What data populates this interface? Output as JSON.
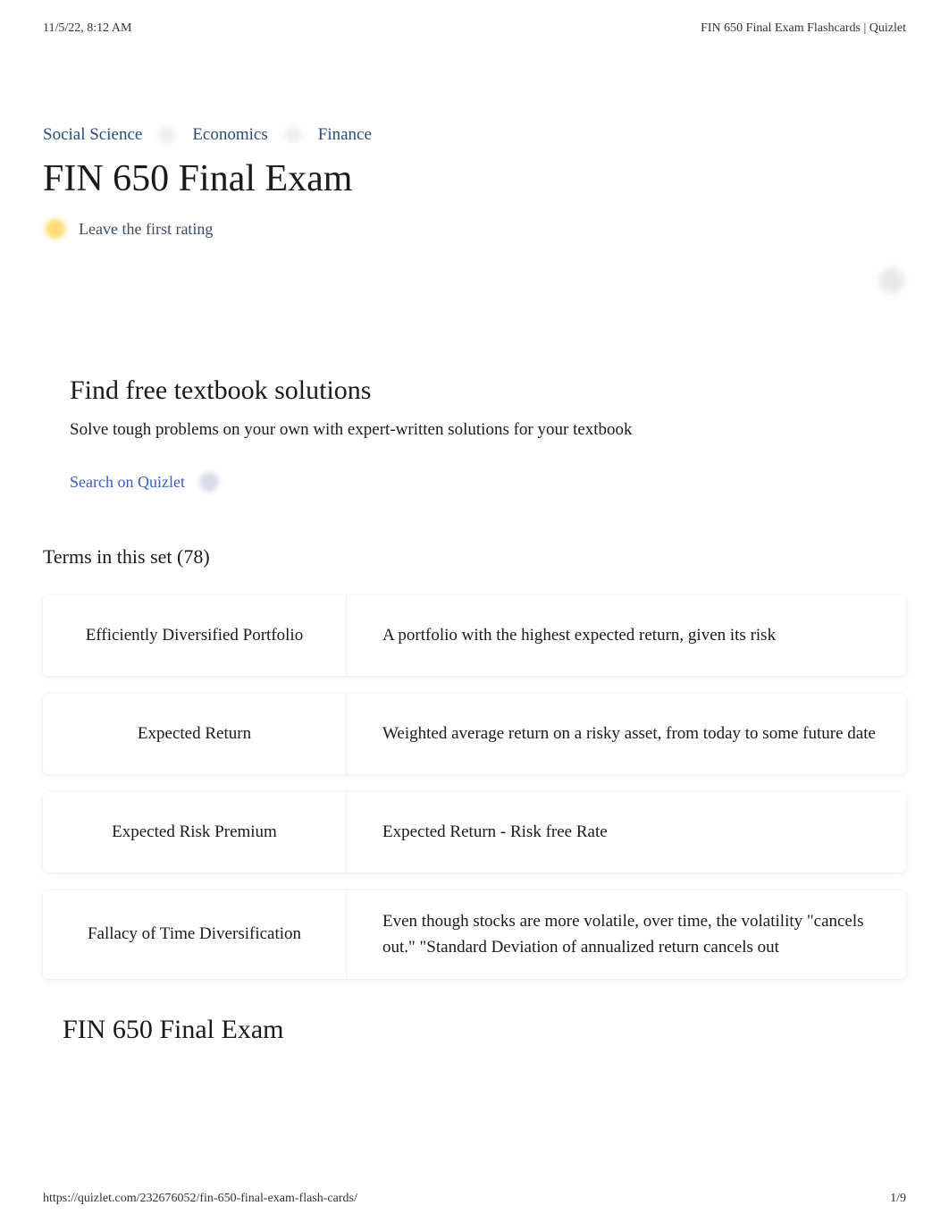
{
  "header": {
    "timestamp": "11/5/22, 8:12 AM",
    "doc_title": "FIN 650 Final Exam Flashcards | Quizlet"
  },
  "breadcrumb": {
    "items": [
      "Social Science",
      "Economics",
      "Finance"
    ]
  },
  "title": "FIN 650 Final Exam",
  "rating": {
    "prompt": "Leave the first rating"
  },
  "promo": {
    "title": "Find free textbook solutions",
    "subtitle": "Solve tough problems on your own with expert-written solutions for your textbook",
    "link_label": "Search on Quizlet"
  },
  "terms": {
    "header": "Terms in this set (78)",
    "cards": [
      {
        "term": "Efficiently Diversified Portfolio",
        "definition": "A portfolio with the highest expected return, given its risk"
      },
      {
        "term": "Expected Return",
        "definition": "Weighted average return on a risky asset, from today to some future date"
      },
      {
        "term": "Expected Risk Premium",
        "definition": "Expected Return - Risk free Rate"
      },
      {
        "term": "Fallacy of Time Diversification",
        "definition": "Even though stocks are more volatile, over time, the volatility \"cancels out.\" \"Standard Deviation of annualized return cancels out"
      }
    ]
  },
  "bottom_title": "FIN 650 Final Exam",
  "footer": {
    "url": "https://quizlet.com/232676052/fin-650-final-exam-flash-cards/",
    "page": "1/9"
  }
}
